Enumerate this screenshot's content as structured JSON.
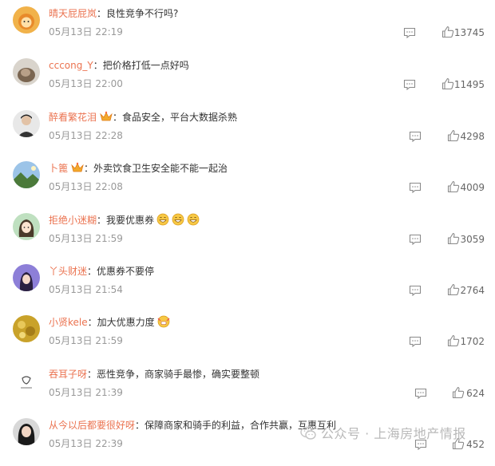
{
  "comments": [
    {
      "user": "晴天屁屁岚",
      "text": "良性竞争不行吗?",
      "time": "05月13日 22:19",
      "likes": "13745",
      "avatar": "avatar-lion"
    },
    {
      "user": "cccong_Y",
      "text": "把价格打低一点好吗",
      "time": "05月13日 22:00",
      "likes": "11495",
      "avatar": "avatar-cat"
    },
    {
      "user": "醉看繁花泪",
      "text": "食品安全，平台大数据杀熟",
      "time": "05月13日 22:28",
      "likes": "4298",
      "avatar": "avatar-man",
      "badge": "crown-badge-icon"
    },
    {
      "user": "卜篦",
      "text": "外卖饮食卫生安全能不能一起治",
      "time": "05月13日 22:08",
      "likes": "4009",
      "avatar": "avatar-landscape",
      "badge": "crown-badge-icon"
    },
    {
      "user": "拒绝小迷糊",
      "text": "我要优惠券",
      "time": "05月13日 21:59",
      "likes": "3059",
      "avatar": "avatar-anime-girl",
      "emojis": [
        "grin-emoji",
        "grin-emoji",
        "grin-emoji"
      ]
    },
    {
      "user": "丫头财迷",
      "text": "优惠券不要停",
      "time": "05月13日 21:54",
      "likes": "2764",
      "avatar": "avatar-girl-purple"
    },
    {
      "user": "小贤kele",
      "text": "加大优惠力度",
      "time": "05月13日 21:59",
      "likes": "1702",
      "avatar": "avatar-yellow-food",
      "emojis": [
        "cheer-emoji"
      ]
    },
    {
      "user": "吞耳子呀",
      "text": "恶性竞争，商家骑手最惨，确实要整顿",
      "time": "05月13日 21:39",
      "likes": "624",
      "avatar": "avatar-sketch"
    },
    {
      "user": "从今以后都要很好呀",
      "text": "保障商家和骑手的利益，合作共赢，互惠互利",
      "time": "05月13日 22:39",
      "likes": "452",
      "avatar": "avatar-dark-hair"
    }
  ],
  "separator": "：",
  "watermark": {
    "text": "公众号 · 上海房地产情报",
    "icon": "wechat-logo-icon"
  },
  "colors": {
    "username": "#eb7350",
    "text": "#333333",
    "time": "#999999",
    "icon": "#8a8a8a"
  }
}
